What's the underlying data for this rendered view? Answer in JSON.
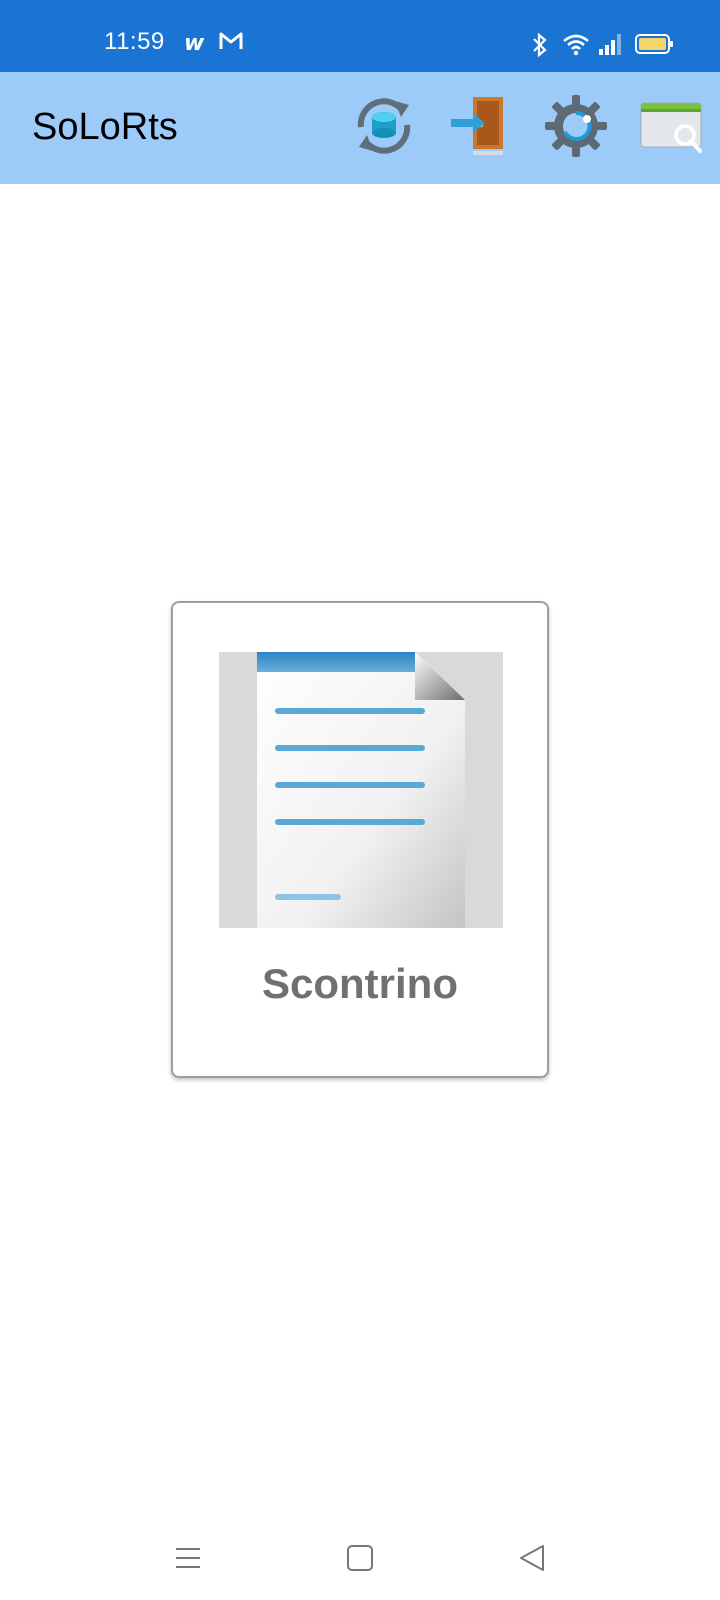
{
  "status_bar": {
    "time": "11:59",
    "app_icons": [
      "w-app-icon",
      "gmail-icon"
    ],
    "system_icons": [
      "bluetooth-icon",
      "wifi-icon",
      "signal-icon",
      "battery-icon"
    ],
    "color": "#1a74d3"
  },
  "app_bar": {
    "title": "SoLoRts",
    "color": "#9dcbf9",
    "actions": [
      "sync-database-icon",
      "exit-door-icon",
      "settings-gear-icon",
      "search-window-icon"
    ]
  },
  "main": {
    "tile": {
      "label": "Scontrino",
      "icon": "receipt-document-icon"
    }
  },
  "nav_bar": {
    "buttons": [
      "menu-icon",
      "home-icon",
      "back-icon"
    ]
  }
}
